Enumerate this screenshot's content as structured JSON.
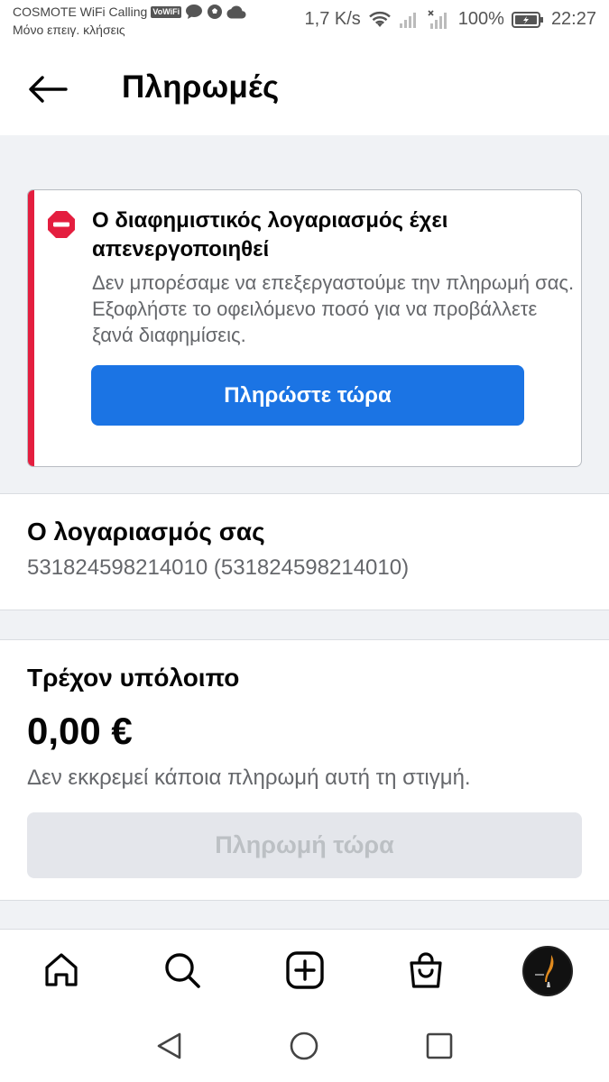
{
  "status_bar": {
    "carrier": "COSMOTE WiFi Calling",
    "vowifi_badge": "VoWiFi",
    "sub_text": "Μόνο επειγ. κλήσεις",
    "net_speed": "1,7 K/s",
    "battery": "100%",
    "time": "22:27"
  },
  "header": {
    "title": "Πληρωμές"
  },
  "alert": {
    "title": "Ο διαφημιστικός λογαριασμός έχει απενεργοποιηθεί",
    "body": "Δεν μπορέσαμε να επεξεργαστούμε την πληρωμή σας. Εξοφλήστε το οφειλόμενο ποσό για να προβάλλετε ξανά διαφημίσεις.",
    "button_label": "Πληρώστε τώρα",
    "accent_color": "#e41e3f"
  },
  "account": {
    "heading": "Ο λογαριασμός σας",
    "id": "531824598214010 (531824598214010)"
  },
  "balance": {
    "heading": "Τρέχον υπόλοιπο",
    "amount": "0,00 €",
    "note": "Δεν εκκρεμεί κάποια πληρωμή αυτή τη στιγμή.",
    "button_label": "Πληρωμή τώρα"
  },
  "tab_bar": {
    "tabs": [
      "home-icon",
      "search-icon",
      "create-icon",
      "shop-icon",
      "profile-avatar"
    ]
  },
  "colors": {
    "primary_button": "#1b74e4",
    "disabled_button": "#e4e6eb",
    "page_background": "#f0f2f5"
  }
}
